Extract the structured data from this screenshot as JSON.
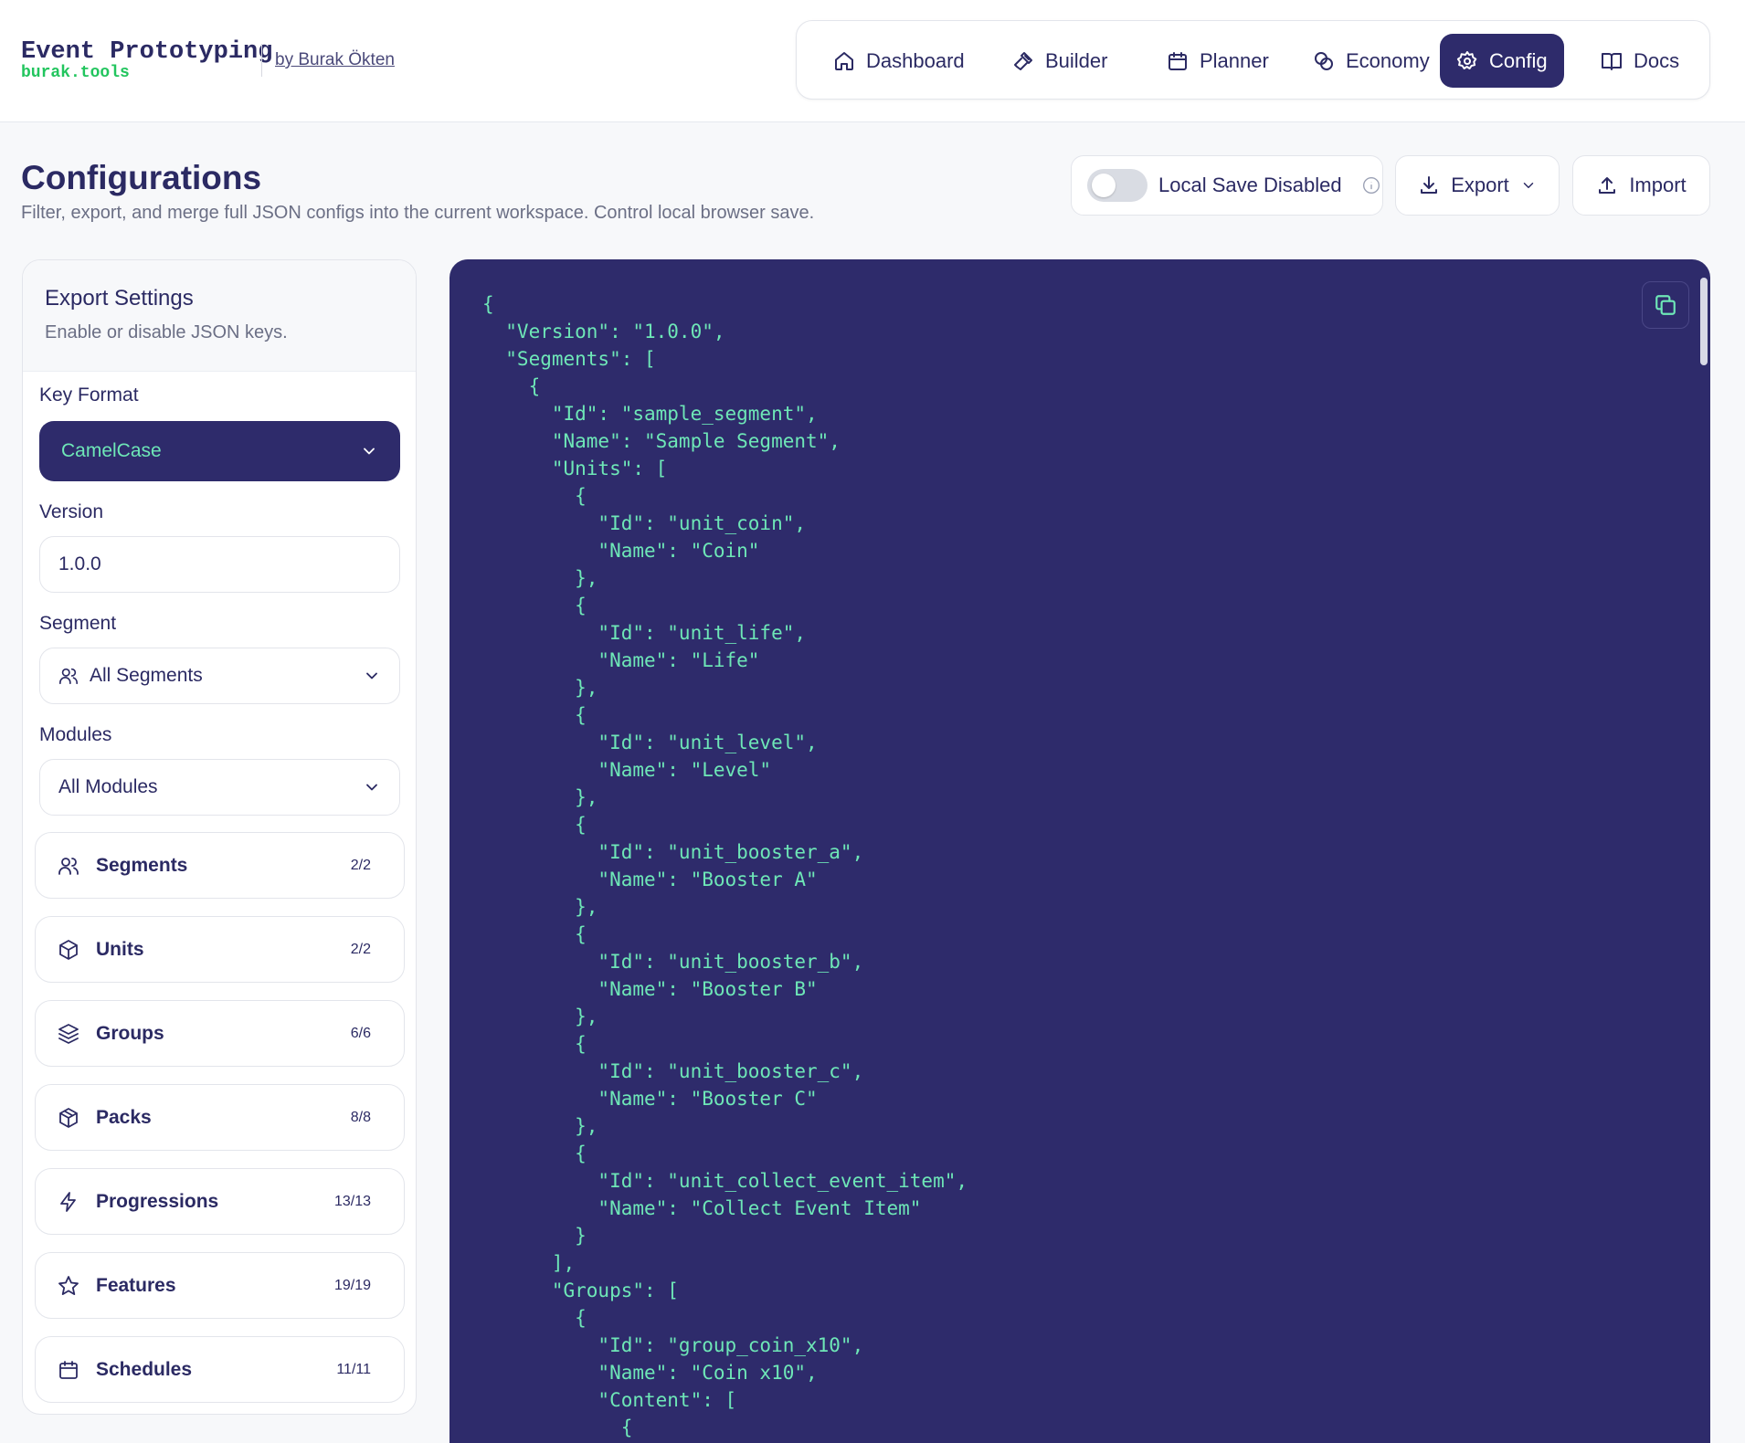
{
  "brand": {
    "title": "Event Prototyping",
    "subtitle": "burak.tools",
    "author": "by Burak Ökten"
  },
  "nav": [
    {
      "label": "Dashboard",
      "icon": "home-icon"
    },
    {
      "label": "Builder",
      "icon": "hammer-icon"
    },
    {
      "label": "Planner",
      "icon": "calendar-icon"
    },
    {
      "label": "Economy",
      "icon": "coins-icon"
    },
    {
      "label": "Config",
      "icon": "gear-icon",
      "active": true
    },
    {
      "label": "Docs",
      "icon": "book-icon"
    }
  ],
  "page": {
    "title": "Configurations",
    "subtitle": "Filter, export, and merge full JSON configs into the current workspace. Control local browser save."
  },
  "toolbar": {
    "local_save_label": "Local Save Disabled",
    "local_save_enabled": false,
    "export_label": "Export",
    "import_label": "Import"
  },
  "sidebar": {
    "title": "Export Settings",
    "subtitle": "Enable or disable JSON keys.",
    "key_format_label": "Key Format",
    "key_format_value": "CamelCase",
    "version_label": "Version",
    "version_value": "1.0.0",
    "segment_label": "Segment",
    "segment_value": "All Segments",
    "modules_label": "Modules",
    "modules_value": "All Modules",
    "modules": [
      {
        "label": "Segments",
        "count": "2/2",
        "icon": "users-icon"
      },
      {
        "label": "Units",
        "count": "2/2",
        "icon": "cube-icon"
      },
      {
        "label": "Groups",
        "count": "6/6",
        "icon": "layers-icon"
      },
      {
        "label": "Packs",
        "count": "8/8",
        "icon": "package-icon"
      },
      {
        "label": "Progressions",
        "count": "13/13",
        "icon": "bolt-icon"
      },
      {
        "label": "Features",
        "count": "19/19",
        "icon": "star-icon"
      },
      {
        "label": "Schedules",
        "count": "11/11",
        "icon": "calendar-icon"
      }
    ]
  },
  "colors": {
    "accent": "#2e2b6b",
    "code_text": "#6ee7b7",
    "brand_green": "#22c55e"
  },
  "json_preview": "{\n  \"Version\": \"1.0.0\",\n  \"Segments\": [\n    {\n      \"Id\": \"sample_segment\",\n      \"Name\": \"Sample Segment\",\n      \"Units\": [\n        {\n          \"Id\": \"unit_coin\",\n          \"Name\": \"Coin\"\n        },\n        {\n          \"Id\": \"unit_life\",\n          \"Name\": \"Life\"\n        },\n        {\n          \"Id\": \"unit_level\",\n          \"Name\": \"Level\"\n        },\n        {\n          \"Id\": \"unit_booster_a\",\n          \"Name\": \"Booster A\"\n        },\n        {\n          \"Id\": \"unit_booster_b\",\n          \"Name\": \"Booster B\"\n        },\n        {\n          \"Id\": \"unit_booster_c\",\n          \"Name\": \"Booster C\"\n        },\n        {\n          \"Id\": \"unit_collect_event_item\",\n          \"Name\": \"Collect Event Item\"\n        }\n      ],\n      \"Groups\": [\n        {\n          \"Id\": \"group_coin_x10\",\n          \"Name\": \"Coin x10\",\n          \"Content\": [\n            {"
}
